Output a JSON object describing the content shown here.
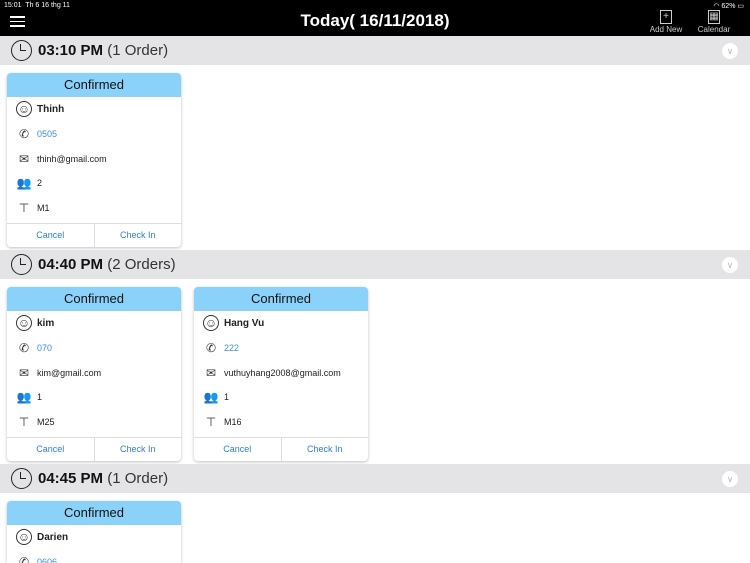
{
  "status_bar": {
    "time": "15:01",
    "date": "Th 6 16 thg 11",
    "battery": "62%"
  },
  "header": {
    "title": "Today( 16/11/2018)",
    "add_new": "Add New",
    "calendar": "Calendar"
  },
  "groups": [
    {
      "time": "03:10 PM",
      "count": "(1 Order)",
      "orders": [
        {
          "status": "Confirmed",
          "name": "Thinh",
          "phone": "0505",
          "email": "thinh@gmail.com",
          "guests": "2",
          "table": "M1",
          "cancel": "Cancel",
          "checkin": "Check In"
        }
      ]
    },
    {
      "time": "04:40 PM",
      "count": "(2 Orders)",
      "orders": [
        {
          "status": "Confirmed",
          "name": "kim",
          "phone": "070",
          "email": "kim@gmail.com",
          "guests": "1",
          "table": "M25",
          "cancel": "Cancel",
          "checkin": "Check In"
        },
        {
          "status": "Confirmed",
          "name": "Hang Vu",
          "phone": "222",
          "email": "vuthuyhang2008@gmail.com",
          "guests": "1",
          "table": "M16",
          "cancel": "Cancel",
          "checkin": "Check In"
        }
      ]
    },
    {
      "time": "04:45 PM",
      "count": "(1 Order)",
      "orders": [
        {
          "status": "Confirmed",
          "name": "Darien",
          "phone": "0606"
        }
      ]
    }
  ]
}
